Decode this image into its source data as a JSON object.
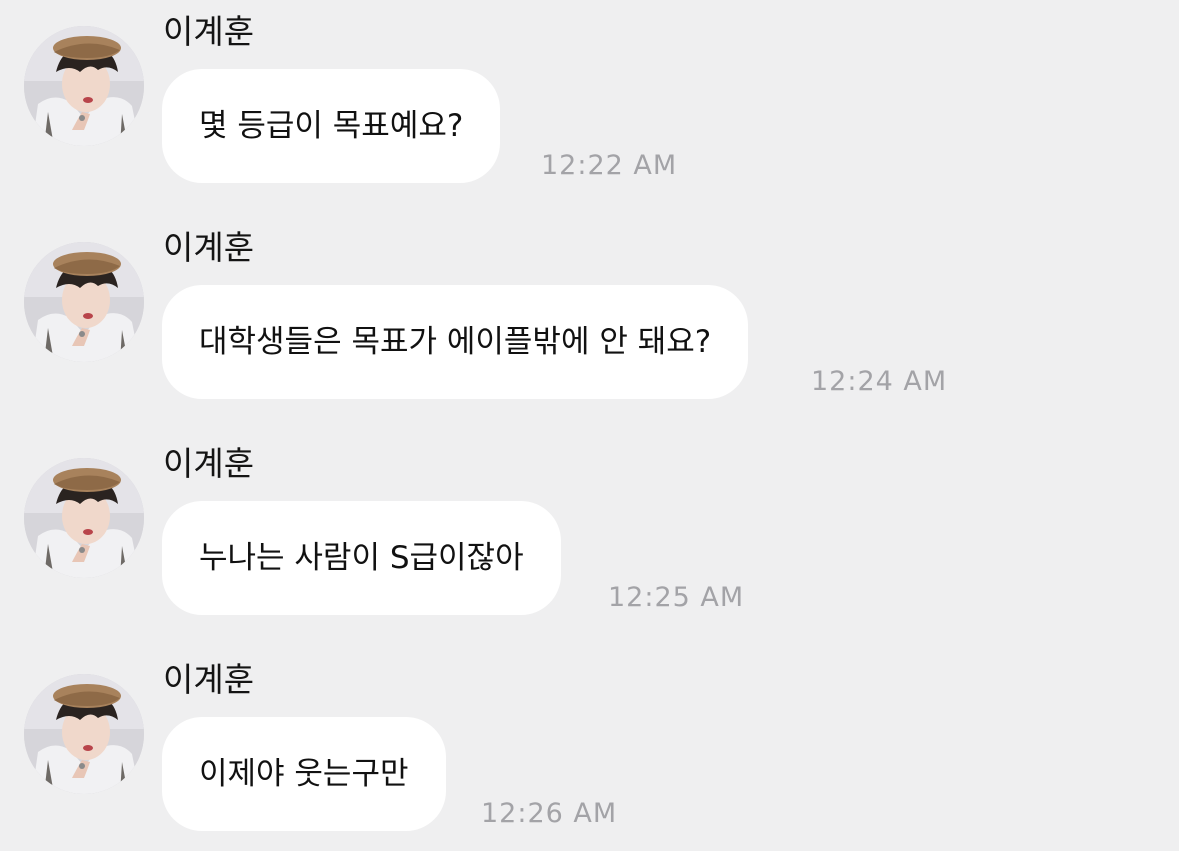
{
  "messages": [
    {
      "sender": "이계훈",
      "text": "몇 등급이 목표예요?",
      "time": "12:22 AM"
    },
    {
      "sender": "이계훈",
      "text": "대학생들은 목표가 에이플밖에 안 돼요?",
      "time": "12:24 AM"
    },
    {
      "sender": "이계훈",
      "text": "누나는 사람이 S급이잖아",
      "time": "12:25 AM"
    },
    {
      "sender": "이계훈",
      "text": "이제야 웃는구만",
      "time": "12:26 AM"
    }
  ],
  "colors": {
    "background": "#efeff0",
    "bubble": "#ffffff",
    "time": "#a3a3a7"
  },
  "icons": {
    "avatar": "profile-photo"
  }
}
